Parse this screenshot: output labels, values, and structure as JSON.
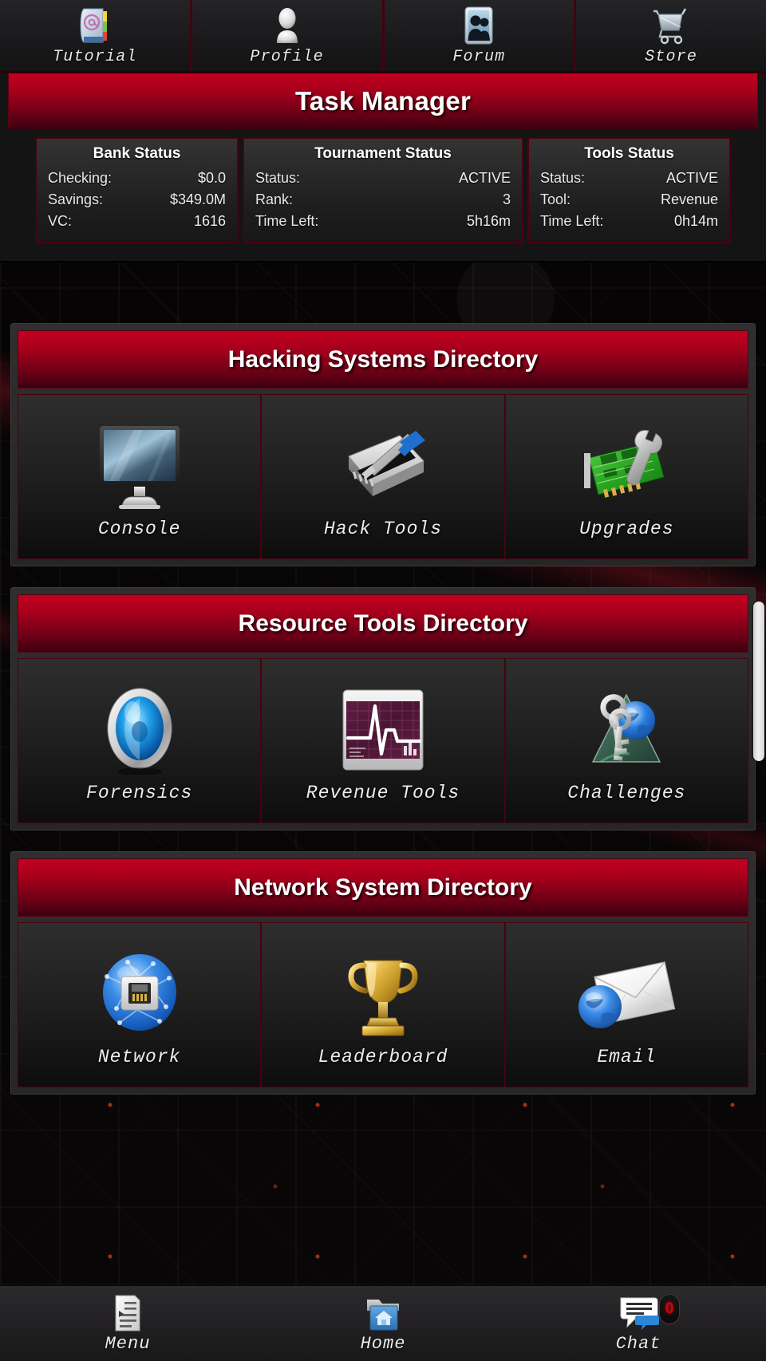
{
  "topbar": {
    "tabs": [
      {
        "label": "Tutorial",
        "icon": "book-at-icon"
      },
      {
        "label": "Profile",
        "icon": "person-silhouette-icon"
      },
      {
        "label": "Forum",
        "icon": "two-people-photo-icon"
      },
      {
        "label": "Store",
        "icon": "shopping-cart-icon"
      }
    ]
  },
  "task_manager": {
    "title": "Task Manager",
    "cards": [
      {
        "heading": "Bank Status",
        "rows": [
          {
            "key": "Checking:",
            "value": "$0.0"
          },
          {
            "key": "Savings:",
            "value": "$349.0M"
          },
          {
            "key": "VC:",
            "value": "1616"
          }
        ]
      },
      {
        "heading": "Tournament Status",
        "rows": [
          {
            "key": "Status:",
            "value": "ACTIVE"
          },
          {
            "key": "Rank:",
            "value": "3"
          },
          {
            "key": "Time Left:",
            "value": "5h16m"
          }
        ]
      },
      {
        "heading": "Tools Status",
        "rows": [
          {
            "key": "Status:",
            "value": "ACTIVE"
          },
          {
            "key": "Tool:",
            "value": "Revenue"
          },
          {
            "key": "Time Left:",
            "value": "0h14m"
          }
        ]
      }
    ]
  },
  "directories": [
    {
      "title": "Hacking Systems Directory",
      "items": [
        {
          "label": "Console",
          "icon": "monitor-icon"
        },
        {
          "label": "Hack Tools",
          "icon": "harddrive-screwdriver-icon"
        },
        {
          "label": "Upgrades",
          "icon": "circuitboard-wrench-icon"
        }
      ]
    },
    {
      "title": "Resource Tools Directory",
      "items": [
        {
          "label": "Forensics",
          "icon": "blue-orb-eye-icon"
        },
        {
          "label": "Revenue Tools",
          "icon": "heartbeat-monitor-icon"
        },
        {
          "label": "Challenges",
          "icon": "keys-globe-icon"
        }
      ]
    },
    {
      "title": "Network System Directory",
      "items": [
        {
          "label": "Network",
          "icon": "network-port-orb-icon"
        },
        {
          "label": "Leaderboard",
          "icon": "trophy-icon"
        },
        {
          "label": "Email",
          "icon": "envelope-globe-icon"
        }
      ]
    }
  ],
  "bottombar": {
    "tabs": [
      {
        "label": "Menu",
        "icon": "list-menu-icon"
      },
      {
        "label": "Home",
        "icon": "home-folder-icon"
      },
      {
        "label": "Chat",
        "icon": "chat-bubbles-icon",
        "badge": "0"
      }
    ]
  },
  "colors": {
    "accent_red": "#c2001f",
    "accent_red_dark": "#3d0010",
    "panel_border": "#4a0010",
    "badge_red": "#d7000f"
  }
}
